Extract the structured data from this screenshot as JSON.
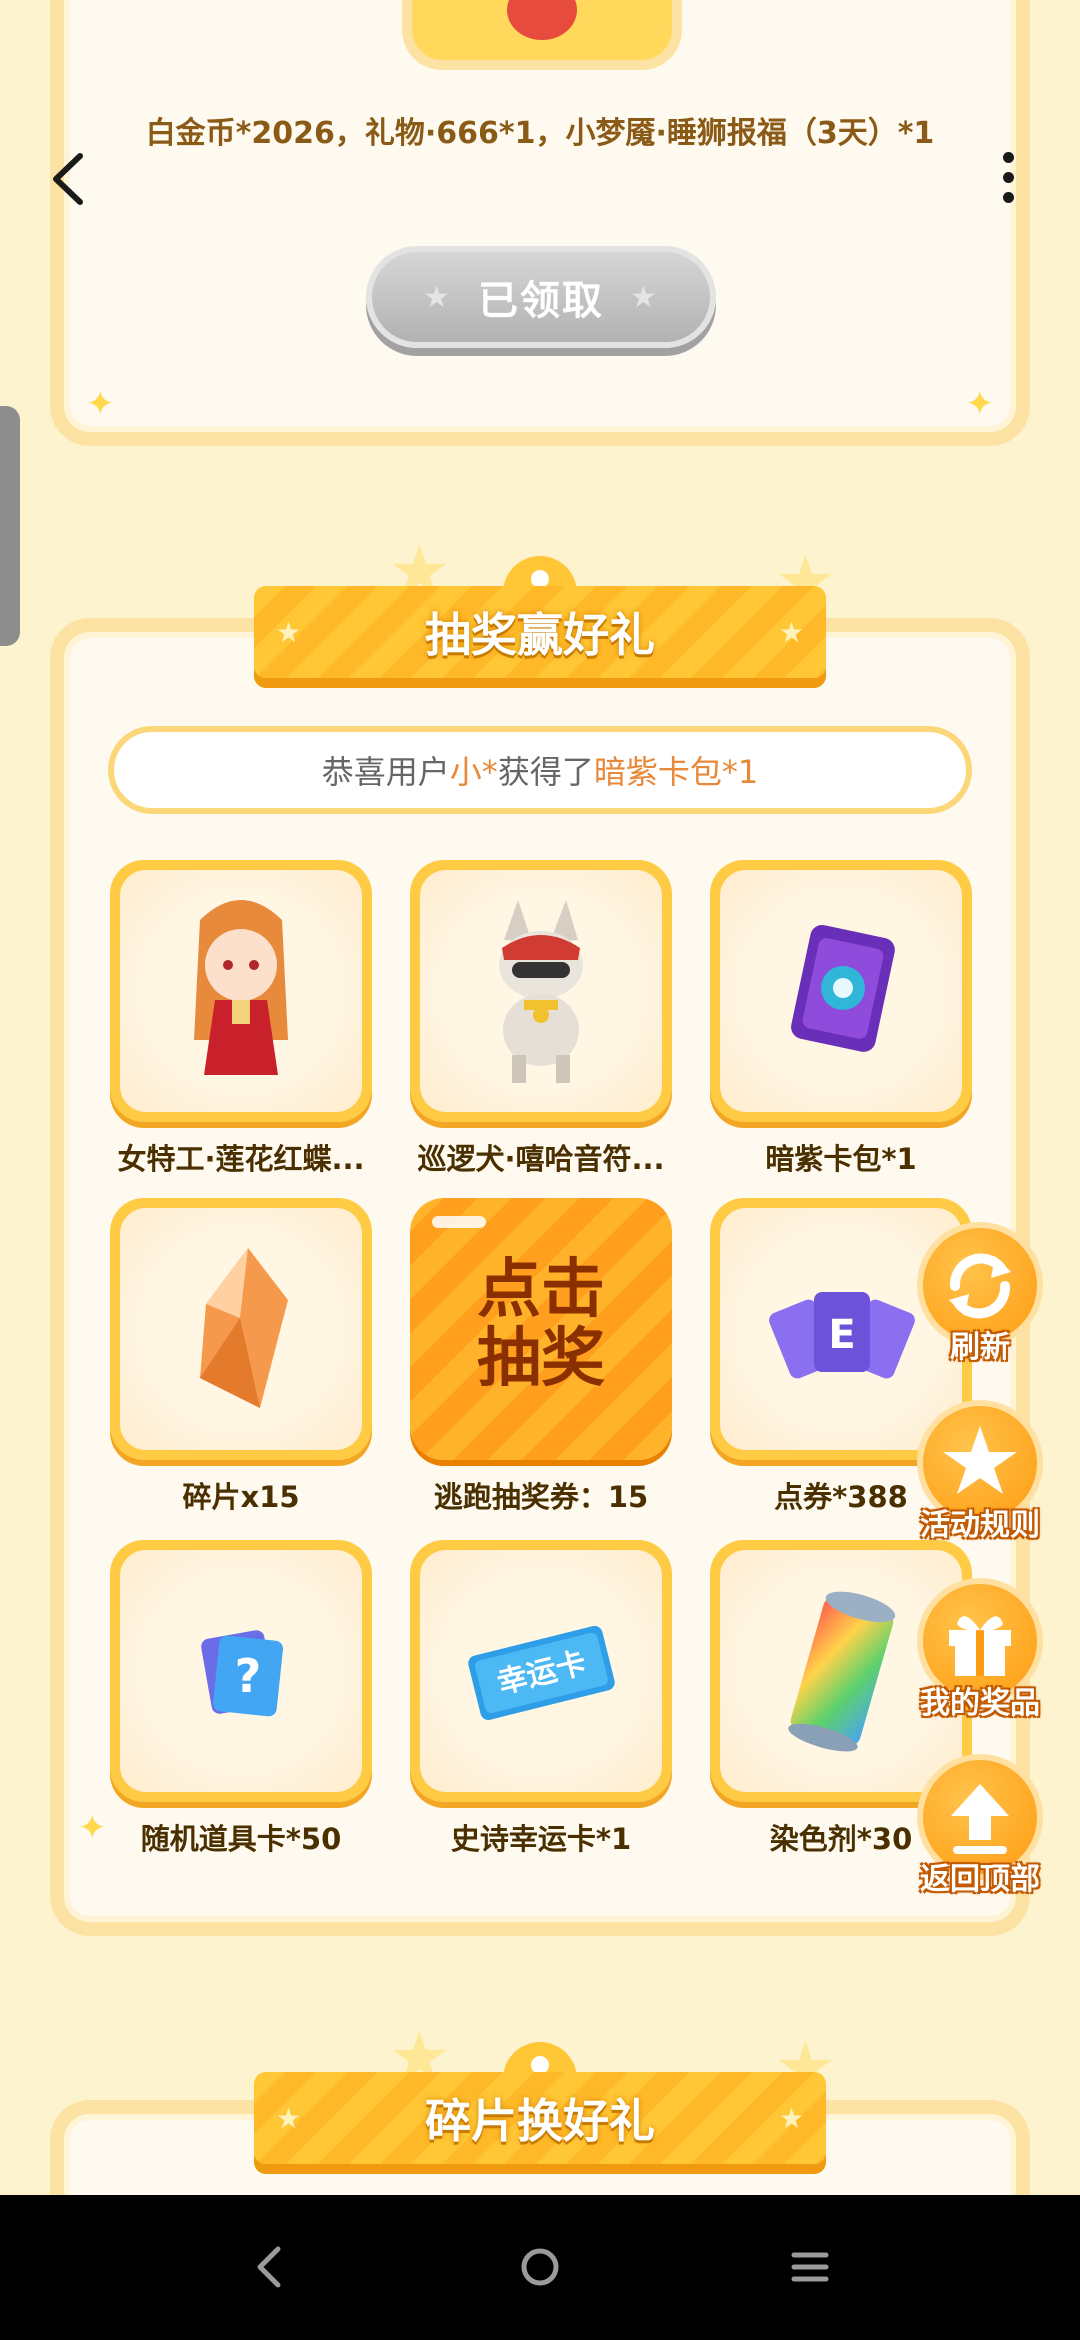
{
  "colors": {
    "background": "#fdf3cf",
    "accent": "#ffc635",
    "text_brown": "#8a5a17",
    "highlight_orange": "#e8893a"
  },
  "top_card": {
    "reward_text": "白金币*2026，礼物·666*1，小梦魇·睡狮报福（3天）*1",
    "claimed_button": "已领取"
  },
  "lottery": {
    "title": "抽奖赢好礼",
    "notice": {
      "prefix": "恭喜用户",
      "user": "小*",
      "middle": "获得了",
      "item": "暗紫卡包*1"
    },
    "prizes": [
      {
        "label": "女特工·莲花红蝶...",
        "icon": "agent-character-icon"
      },
      {
        "label": "巡逻犬·嘻哈音符...",
        "icon": "dog-pet-icon"
      },
      {
        "label": "暗紫卡包*1",
        "icon": "purple-card-pack-icon"
      },
      {
        "label": "碎片x15",
        "icon": "orange-crystal-icon"
      },
      {
        "label": "逃跑抽奖券：15",
        "icon": "draw-button",
        "draw_text_1": "点击",
        "draw_text_2": "抽奖"
      },
      {
        "label": "点券*388",
        "icon": "coupon-cards-icon"
      },
      {
        "label": "随机道具卡*50",
        "icon": "mystery-card-icon"
      },
      {
        "label": "史诗幸运卡*1",
        "icon": "lucky-card-icon",
        "card_text": "幸运卡"
      },
      {
        "label": "染色剂*30",
        "icon": "dye-can-icon"
      }
    ]
  },
  "fragments": {
    "title": "碎片换好礼"
  },
  "float_buttons": [
    {
      "label": "刷新",
      "icon": "refresh-icon"
    },
    {
      "label": "活动规则",
      "icon": "rules-icon"
    },
    {
      "label": "我的奖品",
      "icon": "gift-icon"
    },
    {
      "label": "返回顶部",
      "icon": "back-to-top-icon"
    }
  ]
}
